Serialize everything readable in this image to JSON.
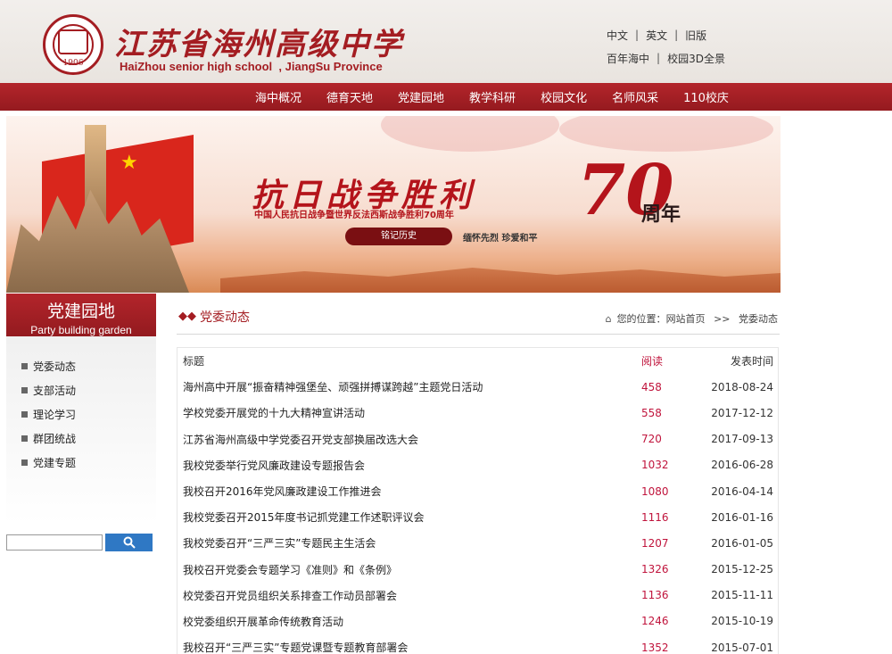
{
  "header": {
    "school_name_cn": "江苏省海州高级中学",
    "school_name_en": "HaiZhou  senior high school  , JiangSu Province",
    "logo_year": "1906",
    "top_links_row1": [
      "中文",
      "英文",
      "旧版"
    ],
    "top_links_row2": [
      "百年海中",
      "校园3D全景"
    ]
  },
  "nav": {
    "items": [
      "海中概况",
      "德育天地",
      "党建园地",
      "教学科研",
      "校园文化",
      "名师风采",
      "110校庆"
    ]
  },
  "banner": {
    "title": "抗日战争胜利",
    "number": "70",
    "suffix": "周年",
    "subtitle": "中国人民抗日战争暨世界反法西斯战争胜利70周年",
    "ribbon": "铭记历史",
    "slogan": "缅怀先烈  珍爱和平"
  },
  "sidebar": {
    "title_cn": "党建园地",
    "title_en": "Party building garden",
    "items": [
      "党委动态",
      "支部活动",
      "理论学习",
      "群团统战",
      "党建专题"
    ]
  },
  "main": {
    "section_title": "党委动态",
    "location_label": "您的位置：",
    "breadcrumb_home": "网站首页",
    "breadcrumb_sep": ">>",
    "breadcrumb_current": "党委动态",
    "table": {
      "headers": {
        "title": "标题",
        "reads": "阅读",
        "date": "发表时间"
      },
      "rows": [
        {
          "title": "海州高中开展“振奋精神强堡垒、顽强拼搏谋跨越”主题党日活动",
          "reads": "458",
          "date": "2018-08-24"
        },
        {
          "title": "学校党委开展党的十九大精神宣讲活动",
          "reads": "558",
          "date": "2017-12-12"
        },
        {
          "title": "江苏省海州高级中学党委召开党支部换届改选大会",
          "reads": "720",
          "date": "2017-09-13"
        },
        {
          "title": "我校党委举行党风廉政建设专题报告会",
          "reads": "1032",
          "date": "2016-06-28"
        },
        {
          "title": "我校召开2016年党风廉政建设工作推进会",
          "reads": "1080",
          "date": "2016-04-14"
        },
        {
          "title": "我校党委召开2015年度书记抓党建工作述职评议会",
          "reads": "1116",
          "date": "2016-01-16"
        },
        {
          "title": "我校党委召开“三严三实”专题民主生活会",
          "reads": "1207",
          "date": "2016-01-05"
        },
        {
          "title": "我校召开党委会专题学习《准则》和《条例》",
          "reads": "1326",
          "date": "2015-12-25"
        },
        {
          "title": "校党委召开党员组织关系排查工作动员部署会",
          "reads": "1136",
          "date": "2015-11-11"
        },
        {
          "title": "校党委组织开展革命传统教育活动",
          "reads": "1246",
          "date": "2015-10-19"
        },
        {
          "title": "我校召开“三严三实”专题党课暨专题教育部署会",
          "reads": "1352",
          "date": "2015-07-01"
        }
      ]
    }
  },
  "colors": {
    "brand_red": "#a41d22",
    "read_count": "#c0143c",
    "search_button": "#2f78c4"
  }
}
